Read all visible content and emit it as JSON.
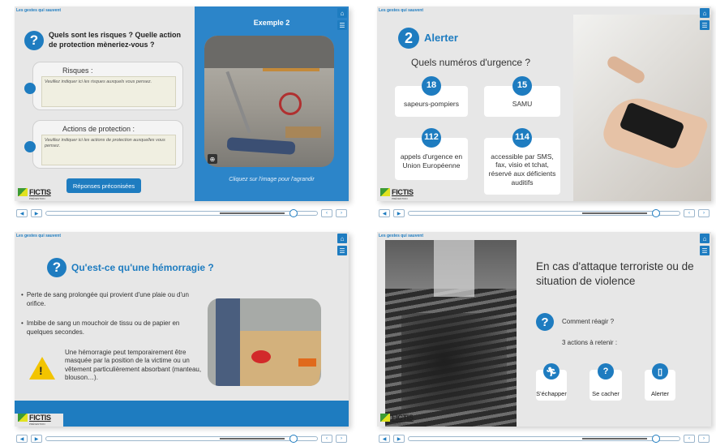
{
  "course_title": "Les gestes qui sauvent",
  "logo": {
    "name": "FICTIS",
    "sub": "PRÉVENTION"
  },
  "panel1": {
    "question": "Quels sont les risques ? Quelle action de protection mèneriez-vous ?",
    "risks_label": "Risques :",
    "risks_placeholder": "Veuillez indiquer ici les risques auxquels vous pensez.",
    "actions_label": "Actions de protection :",
    "actions_placeholder": "Veuillez indiquer ici les actions de protection auxquelles vous pensez.",
    "answers_button": "Réponses préconisées",
    "example_title": "Exemple 2",
    "image_caption": "Cliquez sur l'image pour l'agrandir"
  },
  "panel2": {
    "step_number": "2",
    "title": "Alerter",
    "question": "Quels numéros d'urgence ?",
    "numbers": [
      {
        "num": "18",
        "label": "sapeurs-pompiers"
      },
      {
        "num": "15",
        "label": "SAMU"
      },
      {
        "num": "112",
        "label": "appels d'urgence en Union Européenne"
      },
      {
        "num": "114",
        "label": "accessible par SMS, fax, visio et tchat, réservé aux déficients auditifs"
      }
    ]
  },
  "panel3": {
    "title": "Qu'est-ce qu'une hémorragie ?",
    "bullets": [
      "Perte de sang prolongée qui provient d'une plaie ou d'un orifice.",
      "Imbibe de sang un mouchoir de tissu ou de papier en quelques secondes."
    ],
    "warning": "Une hémorragie peut temporairement être masquée par la position de la victime ou un vêtement particulièrement absorbant (manteau, blouson…)."
  },
  "panel4": {
    "title": "En cas d'attaque terroriste ou de situation de violence",
    "question": "Comment réagir ?",
    "subtitle": "3 actions à retenir :",
    "actions": [
      "S'échapper",
      "Se cacher",
      "Alerter"
    ]
  },
  "colors": {
    "accent": "#1e7cc0",
    "slide_bg": "#e7e7e7"
  }
}
